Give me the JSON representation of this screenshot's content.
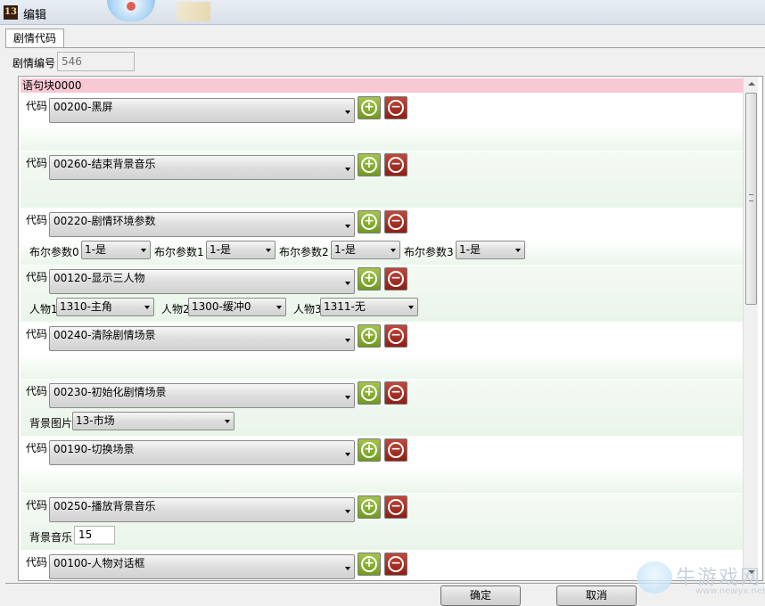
{
  "window": {
    "title": "编辑",
    "app_icon_text": "13"
  },
  "tabs": [
    {
      "label": "剧情代码"
    }
  ],
  "story_id": {
    "label": "剧情编号",
    "value": "546"
  },
  "block_header": "语句块0000",
  "code_label": "代码",
  "statements": [
    {
      "code": "00200-黑屏",
      "params": []
    },
    {
      "code": "00260-结束背景音乐",
      "params": []
    },
    {
      "code": "00220-剧情环境参数",
      "params": [
        {
          "label": "布尔参数0",
          "value": "1-是"
        },
        {
          "label": "布尔参数1",
          "value": "1-是"
        },
        {
          "label": "布尔参数2",
          "value": "1-是"
        },
        {
          "label": "布尔参数3",
          "value": "1-是"
        }
      ]
    },
    {
      "code": "00120-显示三人物",
      "params": [
        {
          "label": "人物1",
          "value": "1310-主角"
        },
        {
          "label": "人物2",
          "value": "1300-缓冲0"
        },
        {
          "label": "人物3",
          "value": "1311-无"
        }
      ]
    },
    {
      "code": "00240-清除剧情场景",
      "params": []
    },
    {
      "code": "00230-初始化剧情场景",
      "params": [
        {
          "label": "背景图片",
          "value": "13-市场"
        }
      ]
    },
    {
      "code": "00190-切换场景",
      "params": []
    },
    {
      "code": "00250-播放背景音乐",
      "params": [
        {
          "label": "背景音乐",
          "value": "15"
        }
      ]
    },
    {
      "code": "00100-人物对话框",
      "params": []
    }
  ],
  "buttons": {
    "ok": "确定",
    "cancel": "取消"
  },
  "colors": {
    "block_header": "#f8c8d4",
    "add_button": "#8bb339",
    "remove_button": "#a8342a"
  },
  "watermark": {
    "text": "牛游戏网",
    "url": "www.newyx.net"
  }
}
